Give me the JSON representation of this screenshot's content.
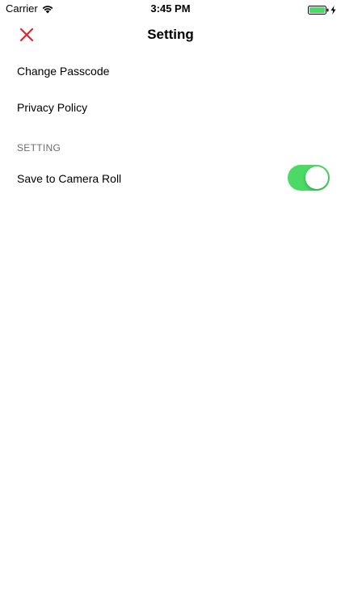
{
  "status_bar": {
    "carrier": "Carrier",
    "time": "3:45 PM",
    "wifi_icon": "wifi-icon",
    "battery_icon": "battery-full-icon",
    "charging_icon": "charging-bolt-icon",
    "battery_color": "#4cd964"
  },
  "nav": {
    "title": "Setting",
    "close_icon": "close-icon",
    "close_color": "#e0242e"
  },
  "rows": {
    "change_passcode": "Change Passcode",
    "privacy_policy": "Privacy Policy"
  },
  "section": {
    "header": "SETTING"
  },
  "toggle_row": {
    "label": "Save to Camera Roll",
    "enabled": true,
    "on_color": "#4cd964"
  }
}
